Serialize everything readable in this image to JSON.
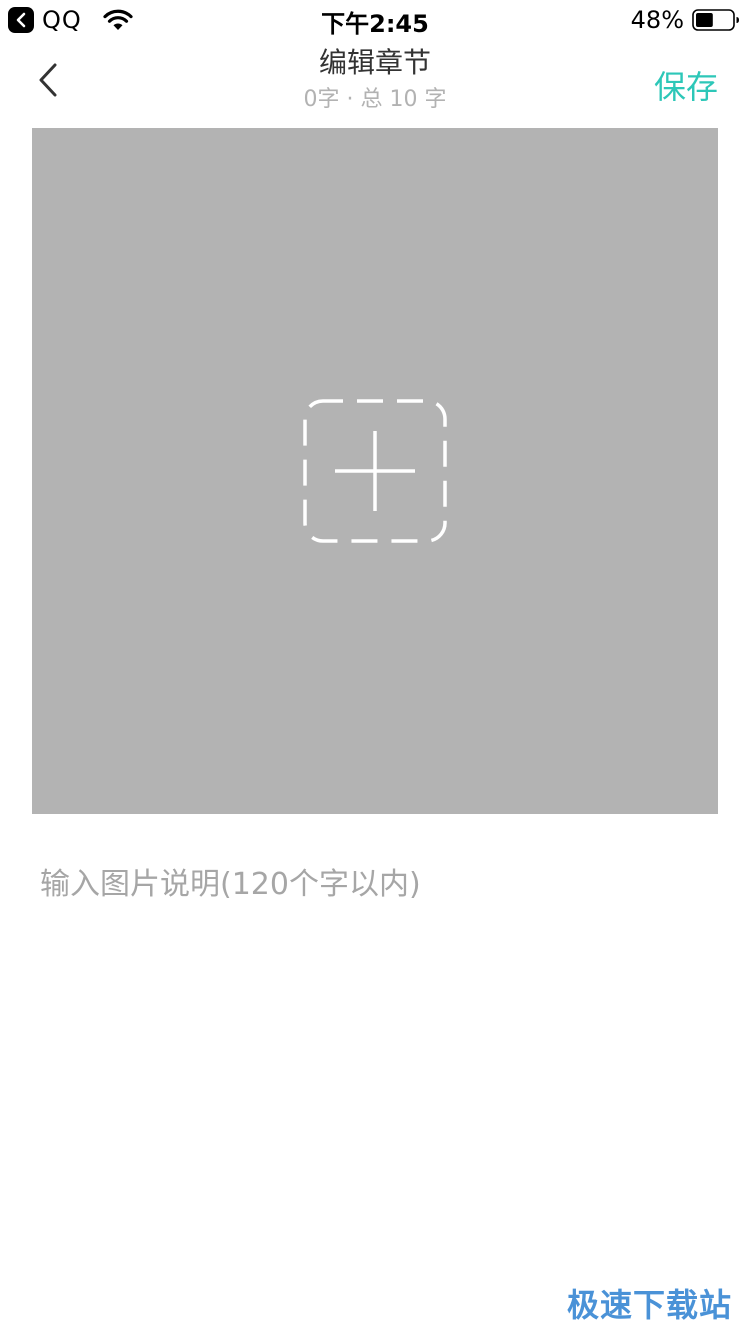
{
  "status_bar": {
    "back_app": "QQ",
    "time": "下午2:45",
    "battery": "48%",
    "battery_level": 0.48
  },
  "nav": {
    "title": "编辑章节",
    "subtitle": "0字 · 总 10 字",
    "save_label": "保存",
    "accent_color": "#2dc7b8"
  },
  "image_area": {
    "icon": "add-image-icon",
    "background": "#b3b3b3"
  },
  "caption": {
    "placeholder": "输入图片说明(120个字以内)",
    "value": ""
  },
  "watermark": {
    "text": "极速下载站"
  }
}
